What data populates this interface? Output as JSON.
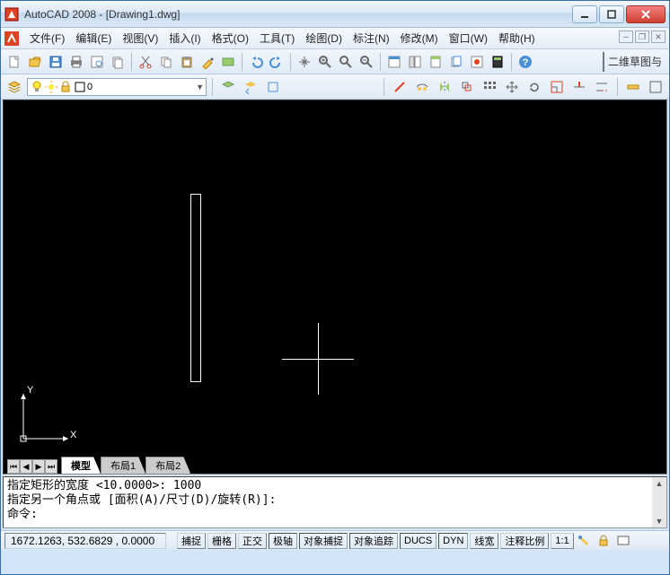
{
  "window": {
    "title": "AutoCAD 2008 - [Drawing1.dwg]"
  },
  "menu": {
    "items": [
      {
        "label": "文件(F)"
      },
      {
        "label": "编辑(E)"
      },
      {
        "label": "视图(V)"
      },
      {
        "label": "插入(I)"
      },
      {
        "label": "格式(O)"
      },
      {
        "label": "工具(T)"
      },
      {
        "label": "绘图(D)"
      },
      {
        "label": "标注(N)"
      },
      {
        "label": "修改(M)"
      },
      {
        "label": "窗口(W)"
      },
      {
        "label": "帮助(H)"
      }
    ]
  },
  "toolbar_right_label": "二维草图与",
  "layer": {
    "current": "0"
  },
  "viewport": {
    "axis_x": "X",
    "axis_y": "Y"
  },
  "tabs": {
    "items": [
      {
        "label": "模型",
        "active": true
      },
      {
        "label": "布局1",
        "active": false
      },
      {
        "label": "布局2",
        "active": false
      }
    ]
  },
  "command": {
    "line1": "指定矩形的宽度 <10.0000>: 1000",
    "line2": "指定另一个角点或 [面积(A)/尺寸(D)/旋转(R)]:",
    "prompt": "命令:"
  },
  "status": {
    "coords": "1672.1263, 532.6829 , 0.0000",
    "buttons": [
      {
        "label": "捕捉",
        "pressed": false
      },
      {
        "label": "栅格",
        "pressed": false
      },
      {
        "label": "正交",
        "pressed": false
      },
      {
        "label": "极轴",
        "pressed": true
      },
      {
        "label": "对象捕捉",
        "pressed": true
      },
      {
        "label": "对象追踪",
        "pressed": true
      },
      {
        "label": "DUCS",
        "pressed": true
      },
      {
        "label": "DYN",
        "pressed": true
      },
      {
        "label": "线宽",
        "pressed": false
      },
      {
        "label": "注释比例",
        "pressed": false
      },
      {
        "label": "1:1",
        "pressed": false
      }
    ]
  }
}
